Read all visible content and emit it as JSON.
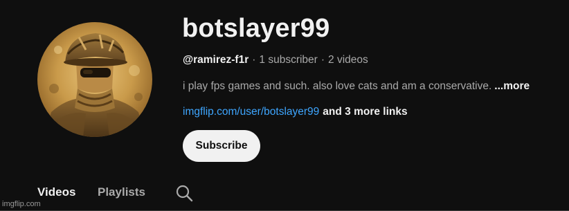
{
  "channel": {
    "name": "botslayer99",
    "handle": "@ramirez-f1r",
    "subscribers": "1 subscriber",
    "videos": "2 videos",
    "separator": "·",
    "description": "i play fps games and such. also love cats and am a conservative.",
    "description_more": "...more",
    "link": "imgflip.com/user/botslayer99",
    "more_links": "and 3 more links"
  },
  "actions": {
    "subscribe_label": "Subscribe"
  },
  "tabs": [
    {
      "label": "Videos",
      "active": true
    },
    {
      "label": "Playlists",
      "active": false
    }
  ],
  "icons": {
    "search": "search-icon",
    "avatar": "soldier-avatar"
  },
  "watermark": "imgflip.com",
  "colors": {
    "background": "#0f0f0f",
    "text_primary": "#f1f1f1",
    "text_secondary": "#aaaaaa",
    "link": "#3ea6ff",
    "button_bg": "#f1f1f1"
  }
}
